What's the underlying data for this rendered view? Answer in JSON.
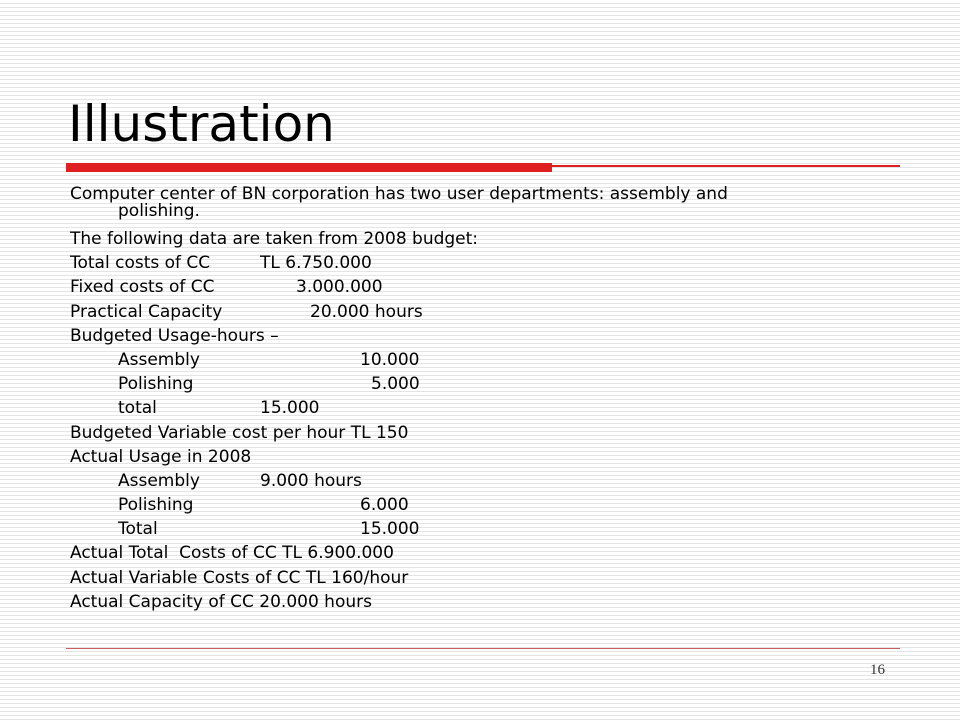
{
  "slide": {
    "title": "Illustration",
    "intro_line1": "Computer center of BN corporation has two user departments: assembly and",
    "intro_line2": "polishing.",
    "budget_intro": "The following data are taken from 2008 budget:",
    "total_costs_label": "Total costs of CC",
    "total_costs_value": "TL 6.750.000",
    "fixed_costs_label": "Fixed costs of CC",
    "fixed_costs_value": "3.000.000",
    "practical_capacity_label": "Practical Capacity",
    "practical_capacity_value": "20.000 hours",
    "budgeted_usage_heading": "Budgeted Usage-hours –",
    "budgeted_usage": [
      {
        "label": "Assembly",
        "value": "10.000"
      },
      {
        "label": "Polishing",
        "value": "5.000"
      },
      {
        "label": "total",
        "value": "15.000"
      }
    ],
    "budgeted_variable_cost": "Budgeted Variable cost per hour TL 150",
    "actual_usage_heading": "Actual Usage in 2008",
    "actual_usage": [
      {
        "label": "Assembly",
        "value": "9.000 hours"
      },
      {
        "label": "Polishing",
        "value": "6.000"
      },
      {
        "label": "Total",
        "value": "15.000"
      }
    ],
    "actual_total_costs": "Actual Total  Costs of CC TL 6.900.000",
    "actual_variable_costs": "Actual Variable Costs of CC TL 160/hour",
    "actual_capacity": "Actual Capacity of CC 20.000 hours",
    "page_number": "16"
  },
  "colors": {
    "accent_red": "#e02020",
    "background_stripe": "#e4e4e4"
  }
}
